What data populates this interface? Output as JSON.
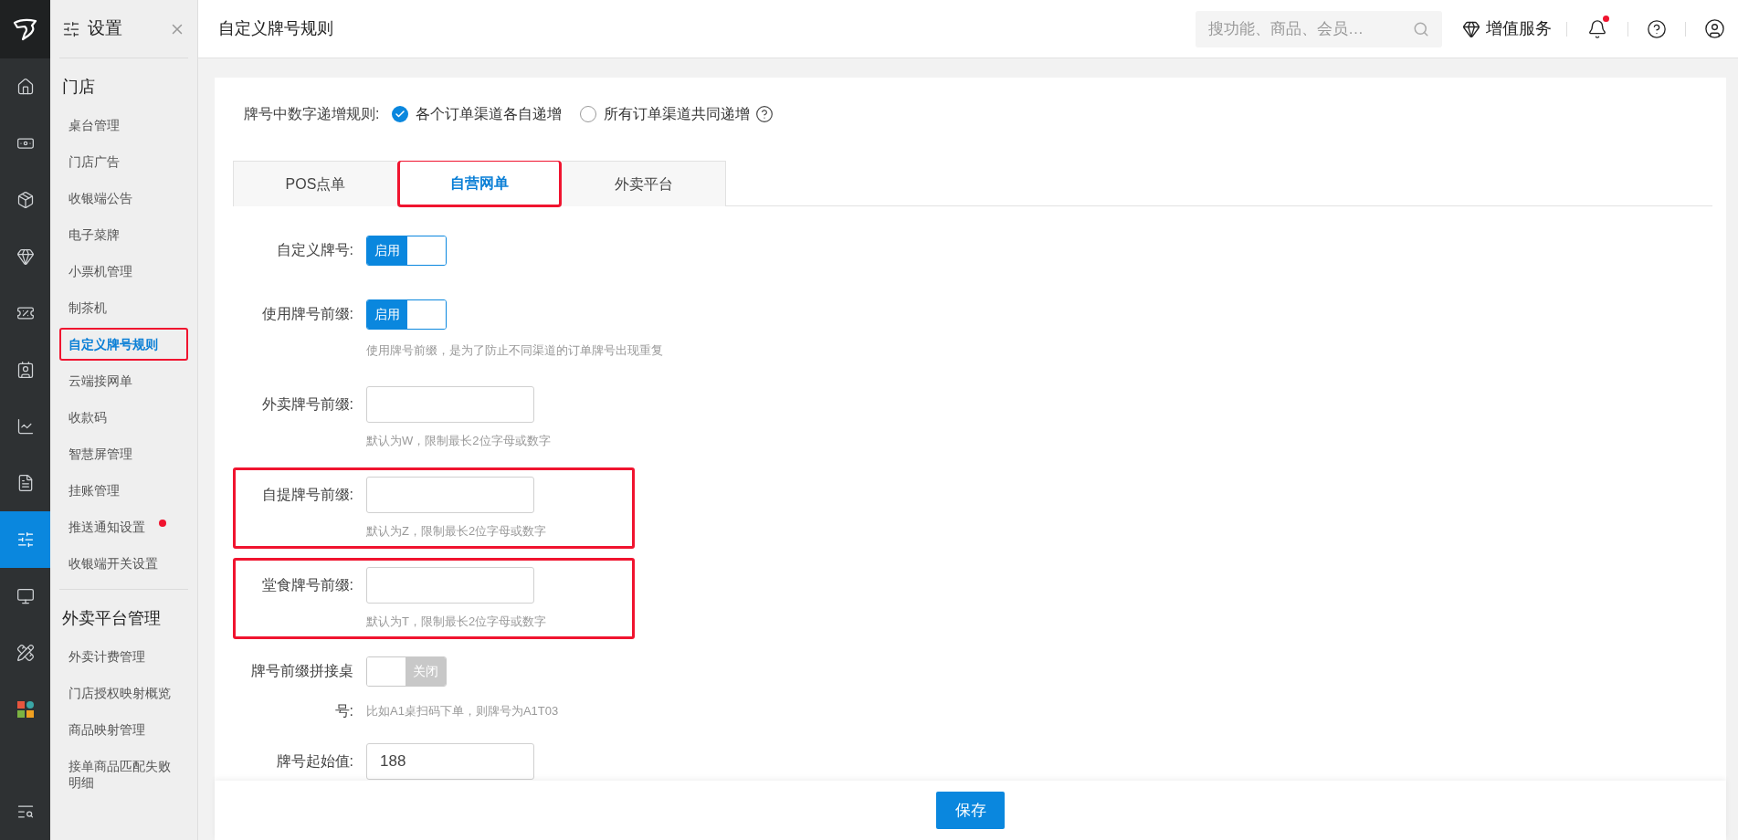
{
  "rail": {
    "items": [
      {
        "selected": false
      },
      {
        "selected": false
      },
      {
        "selected": false
      },
      {
        "selected": false
      },
      {
        "selected": false
      },
      {
        "selected": false
      },
      {
        "selected": false
      },
      {
        "selected": false
      },
      {
        "selected": true
      },
      {
        "selected": false
      },
      {
        "selected": false
      },
      {
        "selected": false
      },
      {
        "selected": false
      }
    ]
  },
  "sidebar": {
    "title": "设置",
    "groups": [
      {
        "title": "门店",
        "items": [
          {
            "label": "桌台管理",
            "selected": false,
            "highlighted": false,
            "dot": false
          },
          {
            "label": "门店广告",
            "selected": false,
            "highlighted": false,
            "dot": false
          },
          {
            "label": "收银端公告",
            "selected": false,
            "highlighted": false,
            "dot": false
          },
          {
            "label": "电子菜牌",
            "selected": false,
            "highlighted": false,
            "dot": false
          },
          {
            "label": "小票机管理",
            "selected": false,
            "highlighted": false,
            "dot": false
          },
          {
            "label": "制茶机",
            "selected": false,
            "highlighted": false,
            "dot": false
          },
          {
            "label": "自定义牌号规则",
            "selected": true,
            "highlighted": true,
            "dot": false
          },
          {
            "label": "云端接网单",
            "selected": false,
            "highlighted": false,
            "dot": false
          },
          {
            "label": "收款码",
            "selected": false,
            "highlighted": false,
            "dot": false
          },
          {
            "label": "智慧屏管理",
            "selected": false,
            "highlighted": false,
            "dot": false
          },
          {
            "label": "挂账管理",
            "selected": false,
            "highlighted": false,
            "dot": false
          },
          {
            "label": "推送通知设置",
            "selected": false,
            "highlighted": false,
            "dot": true
          },
          {
            "label": "收银端开关设置",
            "selected": false,
            "highlighted": false,
            "dot": false
          }
        ]
      },
      {
        "title": "外卖平台管理",
        "items": [
          {
            "label": "外卖计费管理",
            "selected": false,
            "highlighted": false,
            "dot": false
          },
          {
            "label": "门店授权映射概览",
            "selected": false,
            "highlighted": false,
            "dot": false
          },
          {
            "label": "商品映射管理",
            "selected": false,
            "highlighted": false,
            "dot": false
          },
          {
            "label": "接单商品匹配失败明细",
            "selected": false,
            "highlighted": false,
            "dot": false
          }
        ]
      }
    ]
  },
  "header": {
    "title": "自定义牌号规则",
    "search": {
      "placeholder": "搜功能、商品、会员…"
    },
    "value_service": "增值服务",
    "notifications": {
      "unread": true
    }
  },
  "form": {
    "rule": {
      "label": "牌号中数字递增规则:",
      "options": [
        {
          "label": "各个订单渠道各自递增",
          "selected": true
        },
        {
          "label": "所有订单渠道共同递增",
          "selected": false
        }
      ]
    },
    "tabs": [
      {
        "label": "POS点单",
        "selected": false,
        "highlighted": false
      },
      {
        "label": "自营网单",
        "selected": true,
        "highlighted": true
      },
      {
        "label": "外卖平台",
        "selected": false,
        "highlighted": false
      }
    ],
    "fields": [
      {
        "kind": "switch",
        "label": "自定义牌号:",
        "on": true,
        "switch_text": "启用",
        "highlighted": false
      },
      {
        "kind": "switch",
        "label": "使用牌号前缀:",
        "on": true,
        "switch_text": "启用",
        "hint": "使用牌号前缀，是为了防止不同渠道的订单牌号出现重复",
        "highlighted": false
      },
      {
        "kind": "input",
        "label": "外卖牌号前缀:",
        "hint": "默认为W，限制最长2位字母或数字",
        "highlighted": false
      },
      {
        "kind": "input",
        "label": "自提牌号前缀:",
        "hint": "默认为Z，限制最长2位字母或数字",
        "highlighted": true
      },
      {
        "kind": "input",
        "label": "堂食牌号前缀:",
        "hint": "默认为T，限制最长2位字母或数字",
        "highlighted": true
      },
      {
        "kind": "wrapswitch",
        "label": "牌号前缀拼接桌号:",
        "on": false,
        "switch_text": "关闭",
        "hint": "比如A1桌扫码下单，则牌号为A1T03",
        "highlighted": false
      },
      {
        "kind": "input",
        "label": "牌号起始值:",
        "value": "188"
      }
    ]
  },
  "save": "保存"
}
